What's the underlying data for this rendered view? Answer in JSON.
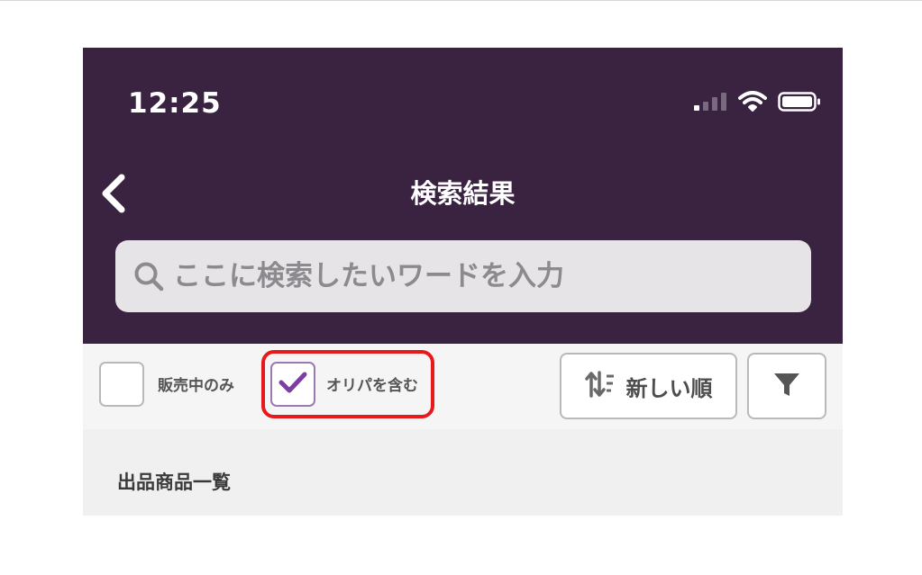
{
  "status_bar": {
    "time": "12:25",
    "icons": [
      "cellular-signal-icon",
      "wifi-icon",
      "battery-icon"
    ]
  },
  "header": {
    "title": "検索結果",
    "back_icon": "chevron-left-icon"
  },
  "search": {
    "placeholder": "ここに検索したいワードを入力",
    "value": ""
  },
  "filters": {
    "on_sale_only": {
      "label": "販売中のみ",
      "checked": false
    },
    "include_oripa": {
      "label": "オリパを含む",
      "checked": true
    },
    "sort_label": "新しい順",
    "sort_icon": "sort-icon",
    "filter_icon": "funnel-icon"
  },
  "section": {
    "title": "出品商品一覧"
  },
  "colors": {
    "header_bg": "#3a2340",
    "accent": "#7a3fa0",
    "highlight": "#e8191c"
  }
}
